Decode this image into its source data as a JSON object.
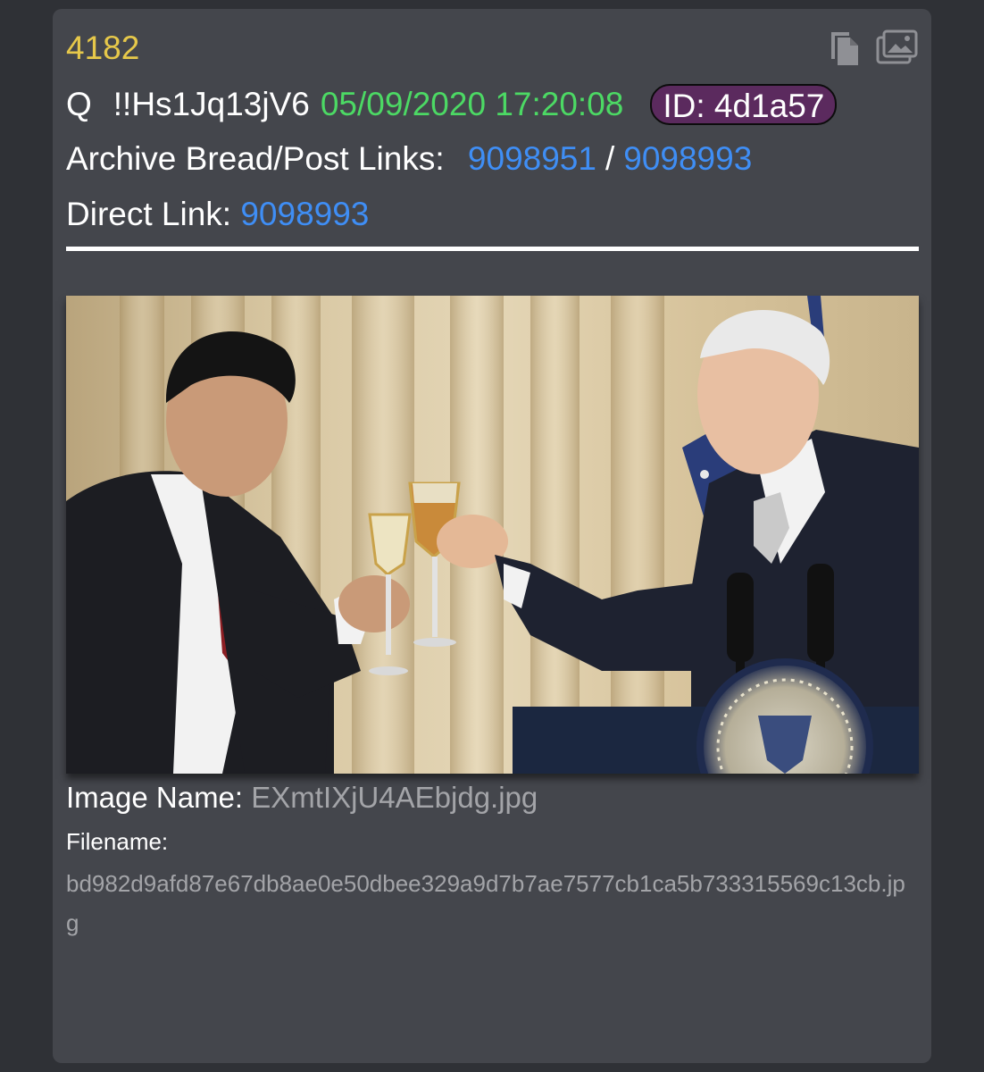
{
  "post": {
    "number": "4182",
    "author": "Q",
    "tripcode": "!!Hs1Jq13jV6",
    "datetime": "05/09/2020 17:20:08",
    "id_label": "ID: 4d1a57",
    "archive_label": "Archive Bread/Post Links:",
    "archive_link_bread": "9098951",
    "archive_link_separator": "/",
    "archive_link_post": "9098993",
    "direct_label": "Direct Link:",
    "direct_link": "9098993"
  },
  "icons": {
    "copy": "copy-icon",
    "images": "images-icon"
  },
  "image": {
    "name_label": "Image Name:",
    "name_value": "EXmtIXjU4AEbjdg.jpg",
    "filename_label": "Filename:",
    "filename_value": "bd982d9afd87e67db8ae0e50dbee329a9d7b7ae7577cb1ca5b733315569c13cb.jpg"
  },
  "colors": {
    "card_bg": "#44464c",
    "page_bg": "#2f3136",
    "post_number": "#e6c84a",
    "date": "#4cd964",
    "link": "#3f8ef5",
    "id_badge": "#5b2a5e",
    "muted_text": "#a3a4a8"
  }
}
